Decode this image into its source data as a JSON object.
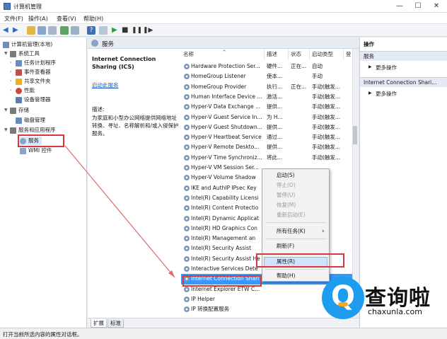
{
  "window": {
    "title": "计算机管理",
    "controls": [
      "—",
      "☐",
      "✕"
    ]
  },
  "menu": [
    "文件(F)",
    "操作(A)",
    "查看(V)",
    "帮助(H)"
  ],
  "tree": {
    "root": "计算机管理(本地)",
    "items": [
      {
        "label": "系统工具",
        "level": 1,
        "expanded": true,
        "icon_color": "#7a7a7a"
      },
      {
        "label": "任务计划程序",
        "level": 2,
        "icon_color": "#6c8cc0"
      },
      {
        "label": "事件查看器",
        "level": 2,
        "icon_color": "#c0504d"
      },
      {
        "label": "共享文件夹",
        "level": 2,
        "icon_color": "#e6b12e"
      },
      {
        "label": "性能",
        "level": 2,
        "icon_color": "#c94a3a"
      },
      {
        "label": "设备管理器",
        "level": 2,
        "icon_color": "#5a7fb0"
      },
      {
        "label": "存储",
        "level": 1,
        "expanded": true,
        "icon_color": "#7a7a7a"
      },
      {
        "label": "磁盘管理",
        "level": 2,
        "icon_color": "#6b8bb5"
      },
      {
        "label": "服务和应用程序",
        "level": 1,
        "expanded": true,
        "icon_color": "#7a7a7a"
      },
      {
        "label": "服务",
        "level": 2,
        "icon_color": "#8aa3c4",
        "highlighted": true
      },
      {
        "label": "WMI 控件",
        "level": 2,
        "icon_color": "#8aa3c4"
      }
    ]
  },
  "center": {
    "header": "服务",
    "selected_service": "Internet Connection Sharing (ICS)",
    "stop_link": "启动此服务",
    "desc_label": "描述:",
    "description": "为家庭和小型办公网络提供网络地址转换、寻址、名称解析和/或入侵保护服务。",
    "columns": [
      "名称",
      "描述",
      "状态",
      "启动类型",
      "登"
    ],
    "rows": [
      {
        "name": "Hardware Protection Ser...",
        "desc": "硬件...",
        "status": "正在...",
        "startup": "自动"
      },
      {
        "name": "HomeGroup Listener",
        "desc": "使本...",
        "status": "",
        "startup": "手动"
      },
      {
        "name": "HomeGroup Provider",
        "desc": "执行...",
        "status": "正在...",
        "startup": "手动(触发..."
      },
      {
        "name": "Human Interface Device ...",
        "desc": "激活...",
        "status": "",
        "startup": "手动(触发..."
      },
      {
        "name": "Hyper-V Data Exchange ...",
        "desc": "提供...",
        "status": "",
        "startup": "手动(触发..."
      },
      {
        "name": "Hyper-V Guest Service In...",
        "desc": "为 H...",
        "status": "",
        "startup": "手动(触发..."
      },
      {
        "name": "Hyper-V Guest Shutdown...",
        "desc": "提供...",
        "status": "",
        "startup": "手动(触发..."
      },
      {
        "name": "Hyper-V Heartbeat Service",
        "desc": "通过...",
        "status": "",
        "startup": "手动(触发..."
      },
      {
        "name": "Hyper-V Remote Deskto...",
        "desc": "提供...",
        "status": "",
        "startup": "手动(触发..."
      },
      {
        "name": "Hyper-V Time Synchroniz...",
        "desc": "将此...",
        "status": "",
        "startup": "手动(触发..."
      },
      {
        "name": "Hyper-V VM Session Ser...",
        "desc": "",
        "status": "",
        "startup": ""
      },
      {
        "name": "Hyper-V Volume Shadow",
        "desc": "",
        "status": "",
        "startup": ""
      },
      {
        "name": "IKE and AuthIP IPsec Key",
        "desc": "",
        "status": "",
        "startup": ""
      },
      {
        "name": "Intel(R) Capability Licensi",
        "desc": "",
        "status": "",
        "startup": ""
      },
      {
        "name": "Intel(R) Content Protectio",
        "desc": "",
        "status": "",
        "startup": ""
      },
      {
        "name": "Intel(R) Dynamic Applicat",
        "desc": "",
        "status": "",
        "startup": ""
      },
      {
        "name": "Intel(R) HD Graphics Con",
        "desc": "",
        "status": "",
        "startup": ""
      },
      {
        "name": "Intel(R) Management an",
        "desc": "",
        "status": "",
        "startup": ""
      },
      {
        "name": "Intel(R) Security Assist",
        "desc": "",
        "status": "",
        "startup": ""
      },
      {
        "name": "Intel(R) Security Assist He",
        "desc": "",
        "status": "",
        "startup": ""
      },
      {
        "name": "Interactive Services Dete",
        "desc": "",
        "status": "",
        "startup": ""
      },
      {
        "name": "Internet Connection Shari",
        "desc": "为家...",
        "status": "",
        "startup": "",
        "selected": true
      },
      {
        "name": "Internet Explorer ETW C...",
        "desc": "",
        "status": "",
        "startup": ""
      },
      {
        "name": "IP Helper",
        "desc": "",
        "status": "",
        "startup": ""
      },
      {
        "name": "IP 转换配置服务",
        "desc": "",
        "status": "",
        "startup": ""
      }
    ],
    "tabs": [
      "扩展",
      "标准"
    ]
  },
  "context_menu": {
    "items": [
      {
        "label": "启动(S)",
        "disabled": false
      },
      {
        "label": "停止(O)",
        "disabled": true
      },
      {
        "label": "暂停(U)",
        "disabled": true
      },
      {
        "label": "恢复(M)",
        "disabled": true
      },
      {
        "label": "重新启动(E)",
        "disabled": true
      },
      {
        "label": "所有任务(K)",
        "disabled": false,
        "submenu": "›"
      },
      {
        "label": "刷新(F)",
        "disabled": false
      },
      {
        "label": "属性(R)",
        "disabled": false,
        "highlighted": true
      },
      {
        "label": "帮助(H)",
        "disabled": false
      }
    ]
  },
  "actions": {
    "title": "操作",
    "sections": [
      {
        "header": "服务",
        "item": "更多操作"
      },
      {
        "header": "Internet Connection Shari...",
        "item": "更多操作"
      }
    ]
  },
  "status": "打开当前所选内容的属性对话框。",
  "watermark": {
    "brand": "查询啦",
    "url": "chaxunla.com"
  },
  "colors": {
    "selection": "#3399ff",
    "annotation": "#d9363e",
    "header_bg": "#e7ecf3"
  }
}
